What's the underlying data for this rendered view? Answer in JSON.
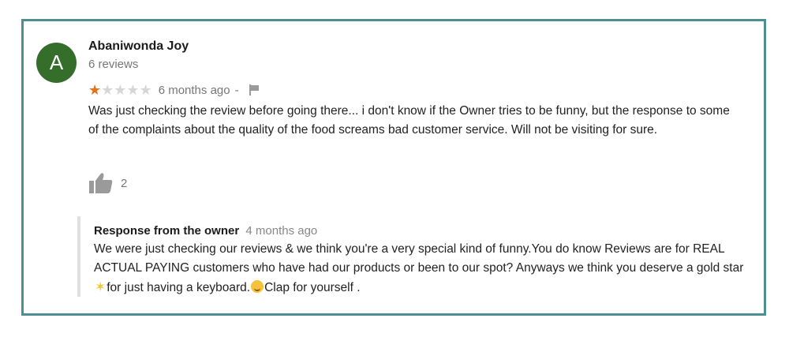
{
  "review": {
    "avatar_letter": "A",
    "author": "Abaniwonda Joy",
    "review_count": "6 reviews",
    "rating": 1,
    "rating_max": 5,
    "time": "6 months ago",
    "separator": "-",
    "text": "Was just checking the review before going there... i don't know if the Owner tries to be funny, but the response to some of the complaints about the quality of the food screams bad customer service. Will not be visiting for sure.",
    "likes": "2"
  },
  "owner_response": {
    "title": "Response from the owner",
    "time": "4 months ago",
    "text_part1": "We were just checking our reviews & we think you're a very special kind of funny.You do know Reviews are for REAL ACTUAL PAYING customers who have had our products or been to our spot? Anyways we think you deserve a gold star",
    "text_part2": "for just having a keyboard.",
    "text_part3": "Clap for yourself ."
  },
  "colors": {
    "border": "#4b8f93",
    "avatar": "#356e2b",
    "star_on": "#e7711b",
    "star_off": "#d6d6d6"
  },
  "icons": [
    "star-icon",
    "flag-icon",
    "thumbs-up-icon",
    "gold-star-emoji",
    "smirk-face-emoji"
  ]
}
